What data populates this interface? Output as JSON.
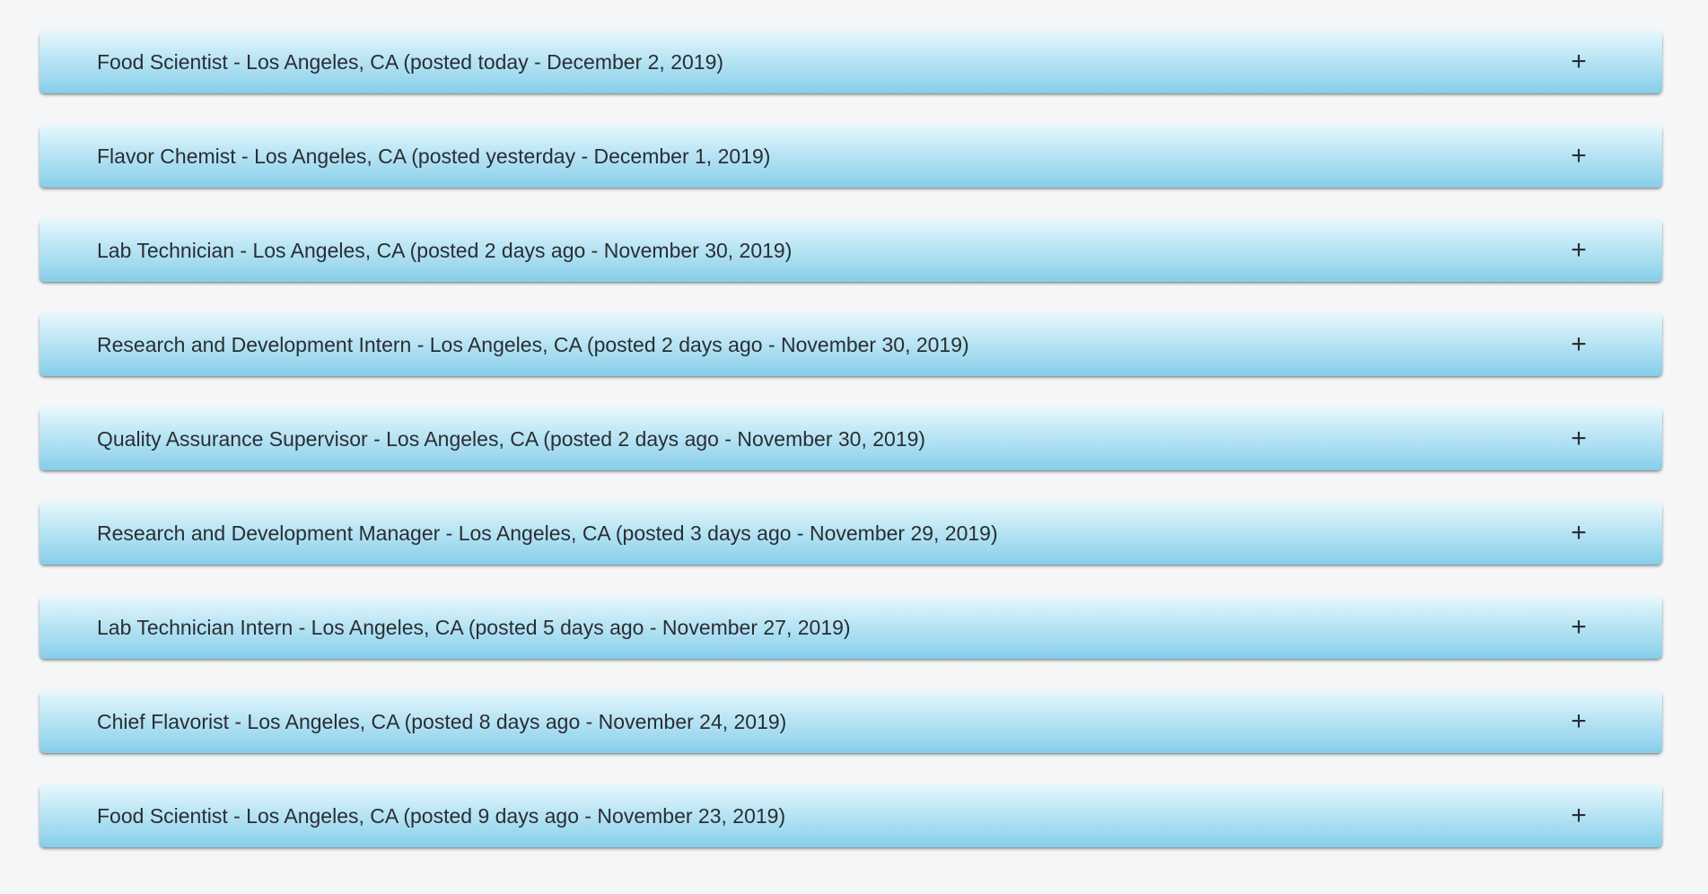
{
  "jobs": [
    {
      "title": "Food Scientist - Los Angeles, CA (posted today - December 2, 2019)",
      "toggle": "+"
    },
    {
      "title": "Flavor Chemist - Los Angeles, CA (posted yesterday - December 1, 2019)",
      "toggle": "+"
    },
    {
      "title": "Lab Technician - Los Angeles, CA (posted 2 days ago - November 30, 2019)",
      "toggle": "+"
    },
    {
      "title": "Research and Development Intern - Los Angeles, CA (posted 2 days ago - November 30, 2019)",
      "toggle": "+"
    },
    {
      "title": "Quality Assurance Supervisor - Los Angeles, CA (posted 2 days ago - November 30, 2019)",
      "toggle": "+"
    },
    {
      "title": "Research and Development Manager - Los Angeles, CA (posted 3 days ago - November 29, 2019)",
      "toggle": "+"
    },
    {
      "title": "Lab Technician Intern - Los Angeles, CA (posted 5 days ago - November 27, 2019)",
      "toggle": "+"
    },
    {
      "title": "Chief Flavorist - Los Angeles, CA (posted 8 days ago - November 24, 2019)",
      "toggle": "+"
    },
    {
      "title": "Food Scientist - Los Angeles, CA (posted 9 days ago - November 23, 2019)",
      "toggle": "+"
    }
  ],
  "colors": {
    "page_background": "#f4f6f8",
    "panel_top": "#e8f8fd",
    "panel_bottom": "#86cde9",
    "text": "#2a2e33"
  }
}
